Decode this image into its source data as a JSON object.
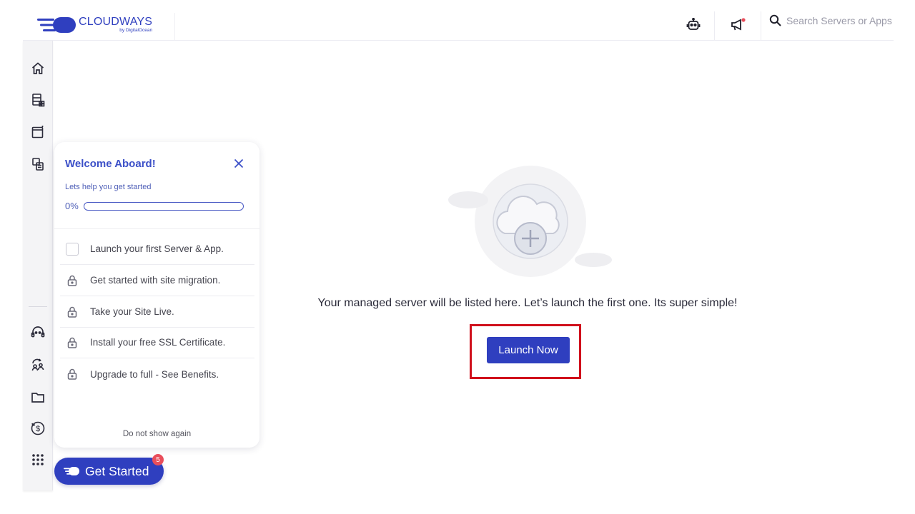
{
  "brand": {
    "name": "CLOUDWAYS",
    "sub": "by DigitalOcean",
    "color": "#2f3fbf"
  },
  "header": {
    "search_placeholder": "Search Servers or Apps",
    "icons": [
      "robot-icon",
      "megaphone-icon",
      "search-icon"
    ]
  },
  "sidebar": {
    "top_items": [
      "home-icon",
      "servers-icon",
      "applications-icon",
      "projects-icon"
    ],
    "bottom_items": [
      "support-icon",
      "team-icon",
      "folder-icon",
      "billing-icon",
      "apps-grid-icon"
    ]
  },
  "onboarding": {
    "title": "Welcome Aboard!",
    "subtitle": "Lets help you get started",
    "progress_label": "0%",
    "progress_value": 0,
    "tasks": [
      {
        "label": "Launch your first Server & App.",
        "state": "unchecked"
      },
      {
        "label": "Get started with site migration.",
        "state": "locked"
      },
      {
        "label": "Take your Site Live.",
        "state": "locked"
      },
      {
        "label": "Install your free SSL Certificate.",
        "state": "locked"
      },
      {
        "label": "Upgrade to full - See Benefits.",
        "state": "locked"
      }
    ],
    "dismiss_label": "Do not show again"
  },
  "get_started": {
    "label": "Get Started",
    "badge": "5"
  },
  "main": {
    "empty_message": "Your managed server will be listed here. Let’s launch the first one. Its super simple!",
    "launch_label": "Launch Now"
  },
  "colors": {
    "accent": "#2f3fbf",
    "highlight": "#d0101c",
    "badge": "#e94e5b"
  }
}
